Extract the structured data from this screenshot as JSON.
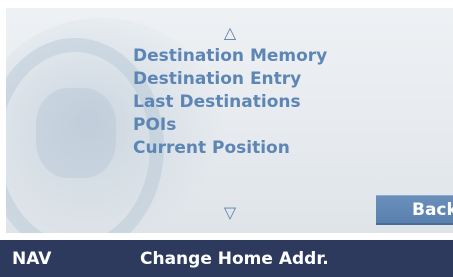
{
  "menu": {
    "scroll_up_icon": "triangle-up-outline",
    "scroll_down_icon": "triangle-down-outline",
    "items": [
      {
        "label": "Destination Memory"
      },
      {
        "label": "Destination Entry"
      },
      {
        "label": "Last Destinations"
      },
      {
        "label": "POIs"
      },
      {
        "label": "Current Position"
      }
    ]
  },
  "buttons": {
    "back_label": "Back"
  },
  "status_bar": {
    "mode": "NAV",
    "action": "Change Home Addr."
  },
  "colors": {
    "menu_text": "#5d86b5",
    "status_bar_bg": "#2d3a5e",
    "back_button_bg": "#5a80ae"
  }
}
